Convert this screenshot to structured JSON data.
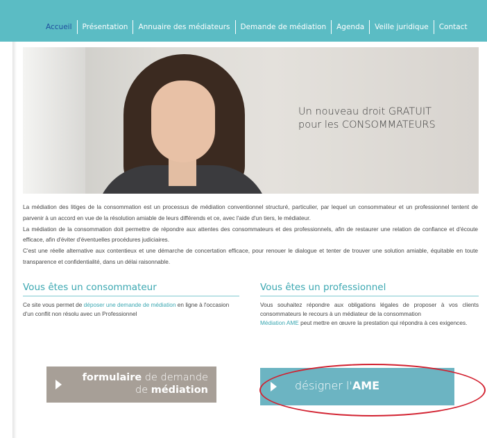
{
  "nav": {
    "items": [
      {
        "label": "Accueil",
        "active": true
      },
      {
        "label": "Présentation"
      },
      {
        "label": "Annuaire des médiateurs"
      },
      {
        "label": "Demande de médiation"
      },
      {
        "label": "Agenda"
      },
      {
        "label": "Veille juridique"
      },
      {
        "label": "Contact"
      }
    ]
  },
  "hero": {
    "line1_prefix": "Un nouveau droit ",
    "line1_emph": "GRATUIT",
    "line2_prefix": "pour les ",
    "line2_emph": "CONSOMMATEURS"
  },
  "intro": {
    "p1": "La médiation des litiges de la consommation est un processus de médiation conventionnel structuré, particulier, par lequel un consommateur et un professionnel tentent de parvenir à un accord en vue de la résolution amiable de leurs différends et ce, avec l'aide d'un tiers, le médiateur.",
    "p2": "La médiation de la consommation doit permettre de répondre aux attentes des consommateurs et des professionnels, afin de restaurer une relation de confiance et d'écoute efficace, afin d'éviter d'éventuelles procédures judiciaires.",
    "p3": "C'est une réelle alternative aux contentieux et une démarche de concertation efficace, pour renouer le dialogue et tenter de trouver une solution amiable, équitable en toute transparence et confidentialité, dans un délai raisonnable."
  },
  "consumer": {
    "title": "Vous êtes un consommateur",
    "text_before": "Ce site vous permet de ",
    "link": "déposer une demande de médiation",
    "text_after": " en ligne à l'occasion d'un conflit non résolu avec un Professionnel"
  },
  "professional": {
    "title": "Vous êtes un professionnel",
    "text1": "Vous souhaitez répondre aux obligations légales de proposer à vos clients consommateurs le recours à un médiateur de la consommation",
    "link": "Médiation AME",
    "text2": " peut mettre en œuvre la prestation qui répondra à ces exigences."
  },
  "buttons": {
    "form_line1_bold": "formulaire",
    "form_line1_rest": " de demande",
    "form_line2_rest": "de ",
    "form_line2_bold": "médiation",
    "ame_prefix": "désigner l'",
    "ame_bold": "AME"
  },
  "colors": {
    "nav_bg": "#5bbcc4",
    "nav_active": "#1e4f9e",
    "accent": "#3aa7b1",
    "form_button": "#a79f97",
    "ame_button": "#6cb4c2",
    "annotation": "#d2202f"
  }
}
